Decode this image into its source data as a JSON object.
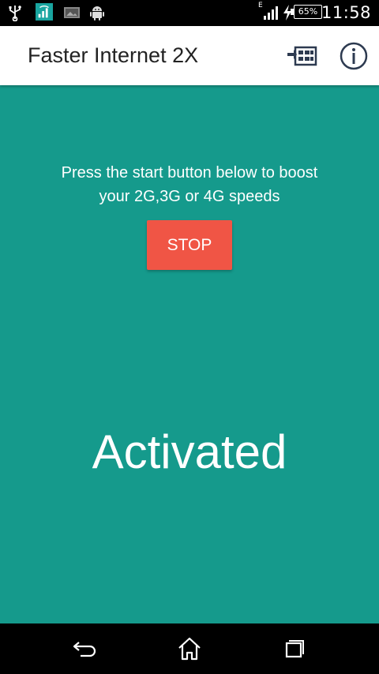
{
  "status_bar": {
    "time": "11:58",
    "battery": "65%",
    "network": "E",
    "icons": [
      "usb-icon",
      "wifi-signal-app-icon",
      "image-notification-icon",
      "android-icon",
      "cell-signal-icon",
      "charging-icon",
      "battery-icon"
    ]
  },
  "app_bar": {
    "title": "Faster Internet 2X",
    "actions": [
      "more-apps-icon",
      "info-icon"
    ]
  },
  "main": {
    "instruction_line1": "Press the start button below to boost",
    "instruction_line2": "your 2G,3G or 4G speeds",
    "button_label": "STOP",
    "status": "Activated"
  },
  "nav_bar": {
    "buttons": [
      "back-icon",
      "home-icon",
      "recent-apps-icon"
    ]
  },
  "colors": {
    "background": "#159a8c",
    "button": "#f05545",
    "app_bar": "#ffffff",
    "text_on_bg": "#ffffff"
  }
}
